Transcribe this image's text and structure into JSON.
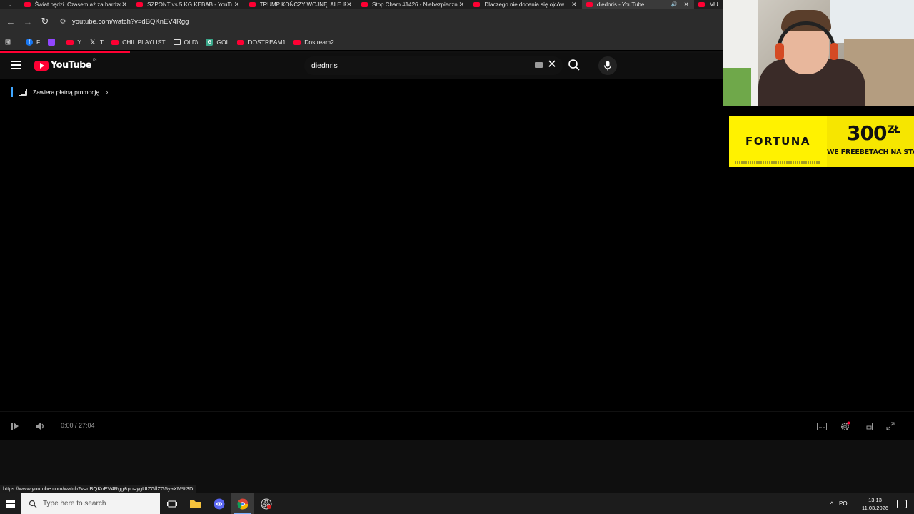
{
  "browser": {
    "tabs": [
      {
        "title": "Świat pędzi. Czasem aż za bardzo",
        "active": false
      },
      {
        "title": "SZPONT vs 5 KG KEBAB - YouTube",
        "active": false
      },
      {
        "title": "TRUMP KOŃCZY WOJNĘ, ALE IRAN",
        "active": false
      },
      {
        "title": "Stop Cham #1426 - Niebezpieczne",
        "active": false
      },
      {
        "title": "Dlaczego nie docenia się ojców",
        "active": false
      },
      {
        "title": "diednris - YouTube",
        "active": true,
        "audio": true
      },
      {
        "title": "MU",
        "active": false
      }
    ],
    "url": "youtube.com/watch?v=dBQKnEV4Rgg",
    "bookmarks": [
      {
        "label": "F",
        "icon": "facebook-icon"
      },
      {
        "label": "",
        "icon": "twitch-icon"
      },
      {
        "label": "Y",
        "icon": "youtube-icon"
      },
      {
        "label": "T",
        "icon": "x-icon"
      },
      {
        "label": "CHIL PLAYLIST",
        "icon": "youtube-icon"
      },
      {
        "label": "OLD\\",
        "icon": "folder-icon"
      },
      {
        "label": "GOL",
        "icon": "g-icon"
      },
      {
        "label": "DOSTREAM1",
        "icon": "youtube-icon"
      },
      {
        "label": "Dostream2",
        "icon": "youtube-icon"
      }
    ],
    "status_url": "https://www.youtube.com/watch?v=dBQKnEV4Rgg&pp=ygUIZGllZG5yaXM%3D",
    "load_progress": 0.18
  },
  "youtube": {
    "logo_text": "YouTube",
    "country_code": "PL",
    "search_value": "diednris",
    "promo_label": "Zawiera płatną promocję",
    "player": {
      "time": "0:00 / 27:04"
    }
  },
  "overlay": {
    "ad": {
      "brand": "FORTUNA",
      "amount": "300",
      "currency": "ZŁ",
      "tagline": "WE FREEBETACH NA STAR"
    }
  },
  "taskbar": {
    "search_placeholder": "Type here to search",
    "language": "POL",
    "time": "13:13",
    "date": "11.03.2026"
  },
  "colors": {
    "youtube_red": "#ff0033",
    "ad_yellow": "#fff200",
    "link_blue": "#3ea6ff"
  }
}
